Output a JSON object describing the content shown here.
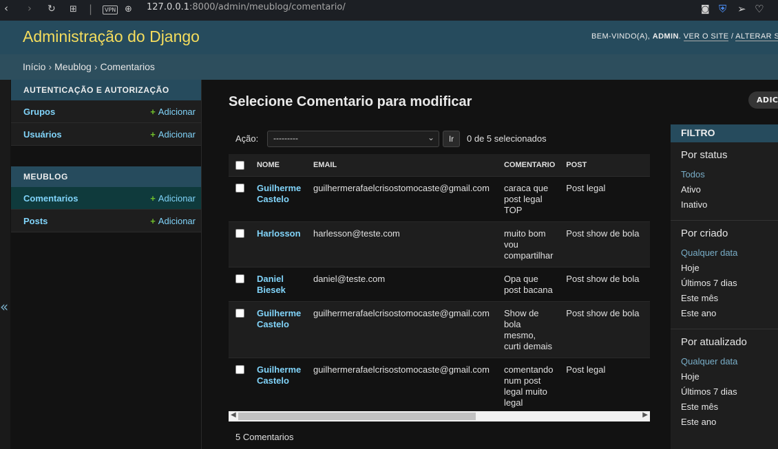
{
  "browser": {
    "back_icon": "back-arrow-icon",
    "forward_icon": "forward-arrow-icon",
    "reload_icon": "reload-icon",
    "vpn_label": "VPN",
    "url_host": "127.0.0.1",
    "url_rest": ":8000/admin/meublog/comentario/"
  },
  "header": {
    "brand": "Administração do Django",
    "welcome": "BEM-VINDO(A),",
    "user": "ADMIN",
    "view_site": "VER O SITE",
    "separator": "/",
    "change_password": "ALTERAR SEN"
  },
  "breadcrumbs": {
    "home": "Início",
    "app": "Meublog",
    "current": "Comentarios",
    "sep": "›"
  },
  "sidebar": {
    "collapse_icon": "«",
    "apps": [
      {
        "caption": "AUTENTICAÇÃO E AUTORIZAÇÃO",
        "models": [
          {
            "name": "Grupos",
            "add": "Adicionar"
          },
          {
            "name": "Usuários",
            "add": "Adicionar"
          }
        ]
      },
      {
        "caption": "MEUBLOG",
        "models": [
          {
            "name": "Comentarios",
            "add": "Adicionar"
          },
          {
            "name": "Posts",
            "add": "Adicionar"
          }
        ]
      }
    ]
  },
  "content": {
    "title": "Selecione Comentario para modificar",
    "add_button": "ADICI"
  },
  "actions": {
    "label": "Ação:",
    "selected_value": "---------",
    "go": "Ir",
    "counter": "0 de 5 selecionados"
  },
  "table": {
    "headers": [
      "NOME",
      "EMAIL",
      "COMENTARIO",
      "POST"
    ],
    "rows": [
      {
        "nome": "Guilherme Castelo",
        "email": "guilhermerafaelcrisostomocaste@gmail.com",
        "comentario": "caraca que post legal TOP",
        "post": "Post legal"
      },
      {
        "nome": "Harlosson",
        "email": "harlesson@teste.com",
        "comentario": "muito bom vou compartilhar",
        "post": "Post show de bola"
      },
      {
        "nome": "Daniel Biesek",
        "email": "daniel@teste.com",
        "comentario": "Opa que post bacana",
        "post": "Post show de bola"
      },
      {
        "nome": "Guilherme Castelo",
        "email": "guilhermerafaelcrisostomocaste@gmail.com",
        "comentario": "Show de bola mesmo, curti demais",
        "post": "Post show de bola"
      },
      {
        "nome": "Guilherme Castelo",
        "email": "guilhermerafaelcrisostomocaste@gmail.com",
        "comentario": "comentando num post legal muito legal",
        "post": "Post legal"
      }
    ]
  },
  "paginator": "5 Comentarios",
  "filter": {
    "title": "FILTRO",
    "sections": [
      {
        "title": "Por status",
        "options": [
          "Todos",
          "Ativo",
          "Inativo"
        ],
        "selected": 0
      },
      {
        "title": "Por criado",
        "options": [
          "Qualquer data",
          "Hoje",
          "Últimos 7 dias",
          "Este mês",
          "Este ano"
        ],
        "selected": 0
      },
      {
        "title": "Por atualizado",
        "options": [
          "Qualquer data",
          "Hoje",
          "Últimos 7 dias",
          "Este mês",
          "Este ano"
        ],
        "selected": 0
      }
    ]
  },
  "colors": {
    "header_bg": "#264b5d",
    "brand": "#f5dd5d",
    "link": "#81d4fa",
    "add_plus": "#70bf2b",
    "filter_selected": "#79aec8"
  }
}
